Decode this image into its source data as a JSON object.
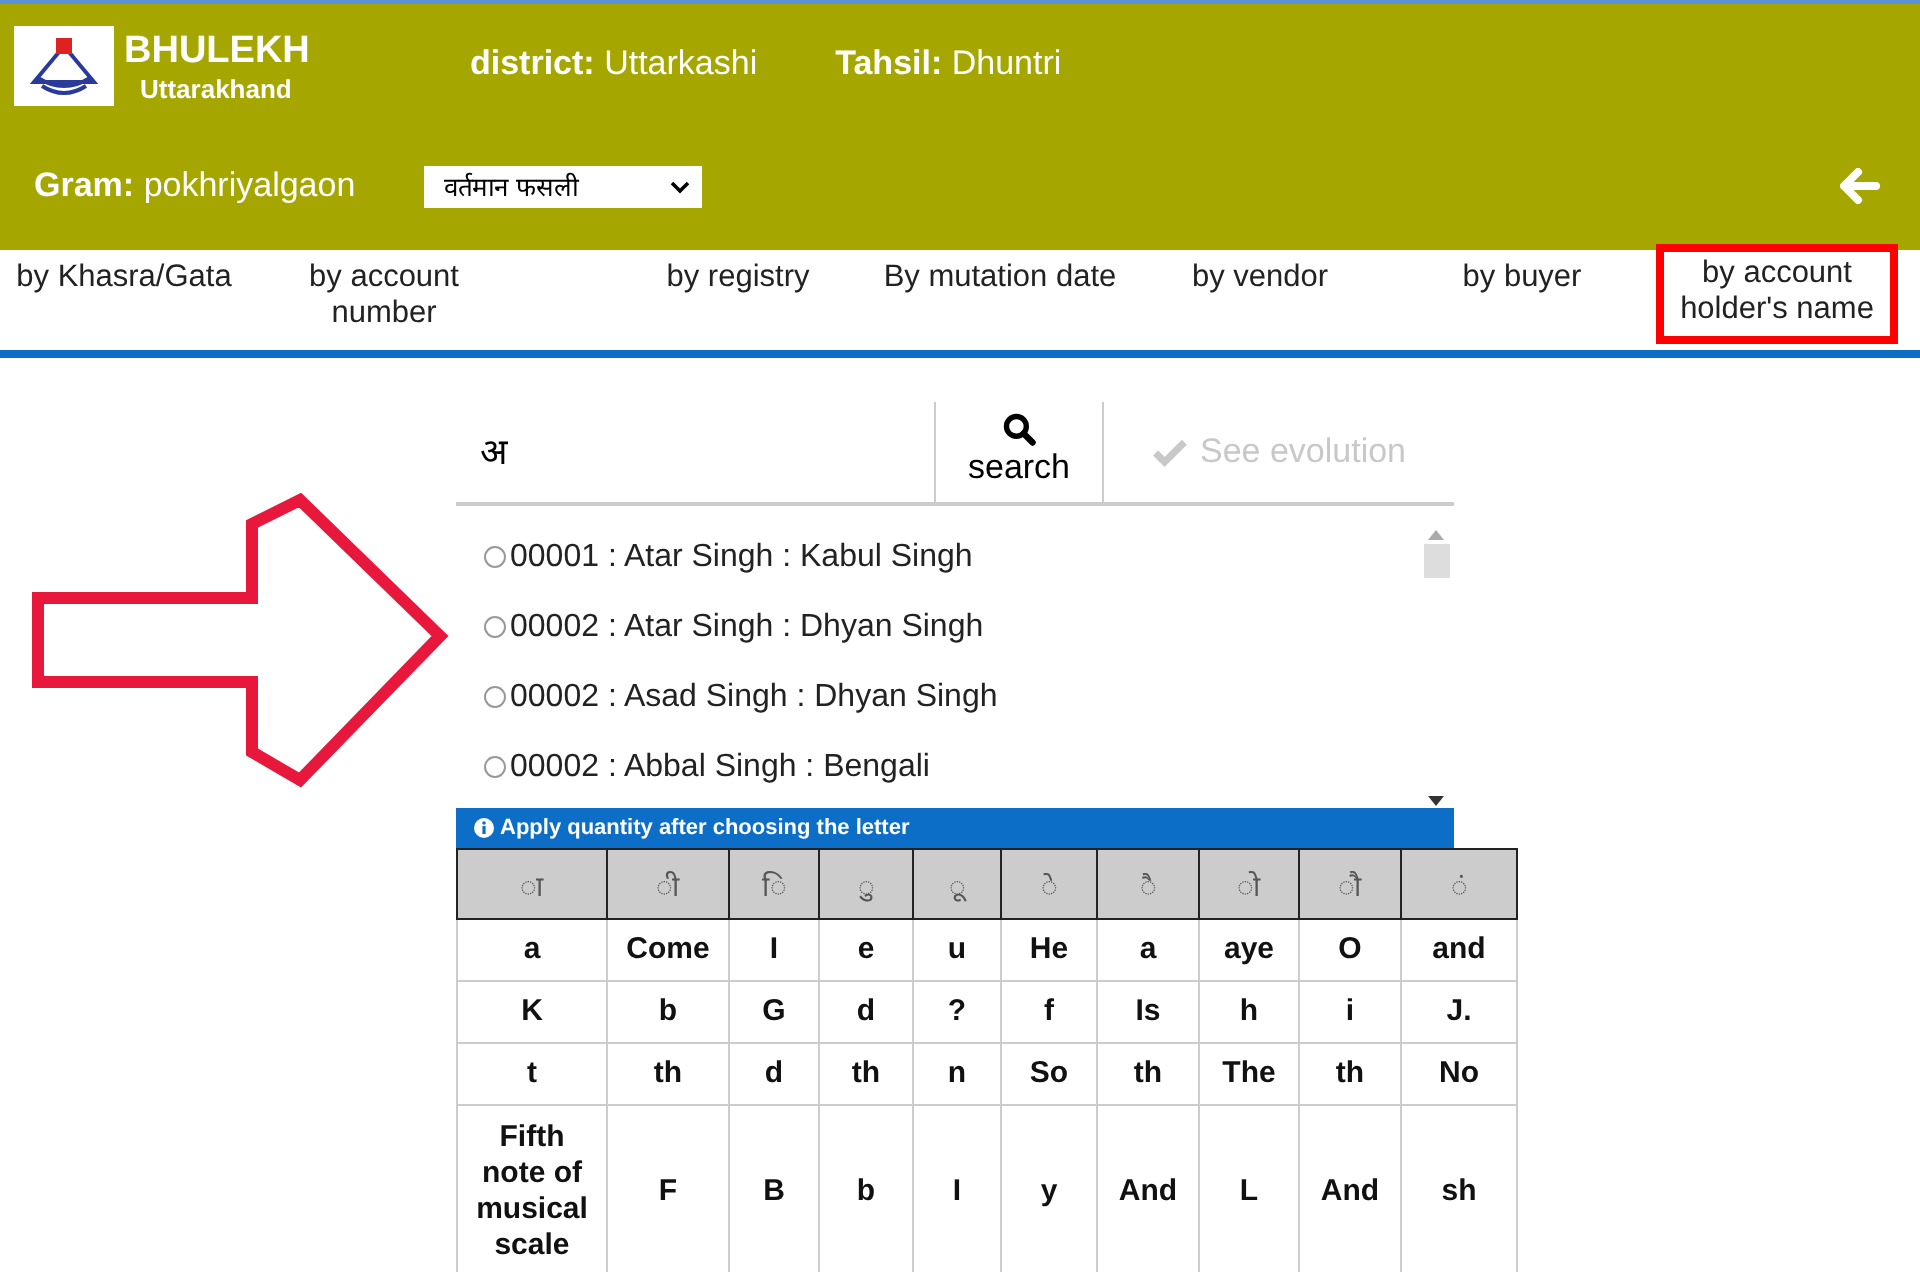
{
  "header": {
    "title": "BHULEKH",
    "subtitle": "Uttarakhand",
    "district": {
      "label": "district:",
      "value": "Uttarkashi"
    },
    "tahsil": {
      "label": "Tahsil:",
      "value": "Dhuntri"
    },
    "gram": {
      "label": "Gram:",
      "value": "pokhriyalgaon"
    },
    "season_select": {
      "value": "वर्तमान फसली"
    }
  },
  "tabs": [
    {
      "label": "by Khasra/Gata",
      "highlighted": false
    },
    {
      "label": "by account number",
      "highlighted": false
    },
    {
      "label": "by registry",
      "highlighted": false
    },
    {
      "label": "By mutation date",
      "highlighted": false
    },
    {
      "label": "by vendor",
      "highlighted": false
    },
    {
      "label": "by buyer",
      "highlighted": false
    },
    {
      "label": "by account holder's name",
      "highlighted": true
    }
  ],
  "search": {
    "value": "अ",
    "button": "search",
    "evolution_button": {
      "label": "See evolution",
      "disabled": true
    }
  },
  "results": [
    {
      "text": "00001 : Atar Singh : Kabul Singh",
      "selected": false
    },
    {
      "text": "00002 : Atar Singh : Dhyan Singh",
      "selected": false
    },
    {
      "text": "00002 : Asad Singh : Dhyan Singh",
      "selected": false
    },
    {
      "text": "00002 : Abbal Singh : Bengali",
      "selected": false
    }
  ],
  "keyboard": {
    "note": "Apply quantity after choosing the letter",
    "headers": [
      "◌ा",
      "◌ी",
      "◌ि",
      "◌ु",
      "◌ू",
      "◌े",
      "◌ै",
      "◌ो",
      "◌ौ",
      "◌ं"
    ],
    "rows": [
      [
        "a",
        "Come",
        "I",
        "e",
        "u",
        "He",
        "a",
        "aye",
        "O",
        "and"
      ],
      [
        "K",
        "b",
        "G",
        "d",
        "?",
        "f",
        "Is",
        "h",
        "i",
        "J."
      ],
      [
        "t",
        "th",
        "d",
        "th",
        "n",
        "So",
        "th",
        "The",
        "th",
        "No"
      ],
      [
        "Fifth note of musical scale",
        "F",
        "B",
        "b",
        "I",
        "y",
        "And",
        "L",
        "And",
        "sh"
      ]
    ]
  }
}
